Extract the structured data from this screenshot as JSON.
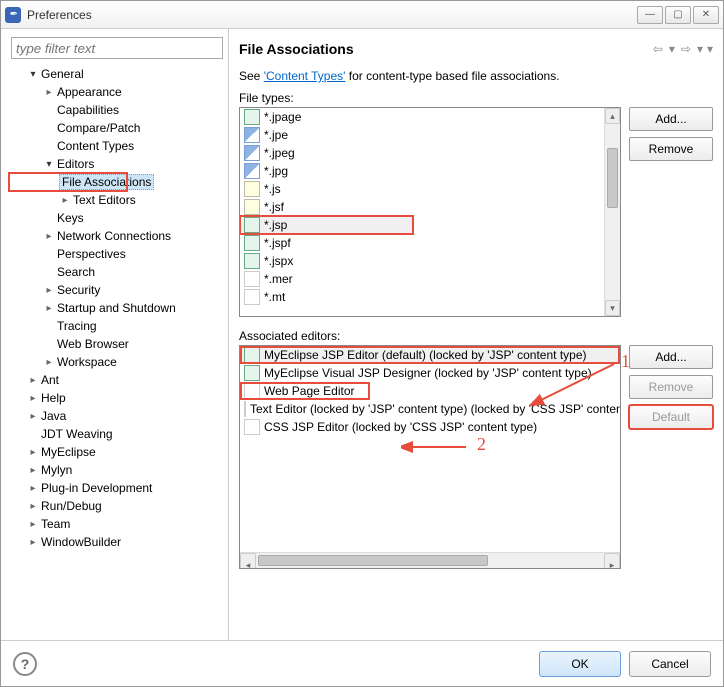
{
  "window": {
    "title": "Preferences"
  },
  "filter_placeholder": "type filter text",
  "tree": {
    "general": "General",
    "appearance": "Appearance",
    "capabilities": "Capabilities",
    "compare": "Compare/Patch",
    "content_types": "Content Types",
    "editors": "Editors",
    "file_assoc": "File Associations",
    "text_editors": "Text Editors",
    "keys": "Keys",
    "network": "Network Connections",
    "perspectives": "Perspectives",
    "search": "Search",
    "security": "Security",
    "startup": "Startup and Shutdown",
    "tracing": "Tracing",
    "web_browser": "Web Browser",
    "workspace": "Workspace",
    "ant": "Ant",
    "help": "Help",
    "java": "Java",
    "jdt": "JDT Weaving",
    "myeclipse": "MyEclipse",
    "mylyn": "Mylyn",
    "plugin": "Plug-in Development",
    "rundebug": "Run/Debug",
    "team": "Team",
    "window_builder": "WindowBuilder"
  },
  "page": {
    "title": "File Associations",
    "intro_pre": "See ",
    "intro_link": "'Content Types'",
    "intro_post": " for content-type based file associations.",
    "file_types_label": "File types:",
    "editors_label": "Associated editors:"
  },
  "file_types": [
    {
      "ext": "*.jpage",
      "icon": "jsp"
    },
    {
      "ext": "*.jpe",
      "icon": "img"
    },
    {
      "ext": "*.jpeg",
      "icon": "img"
    },
    {
      "ext": "*.jpg",
      "icon": "img"
    },
    {
      "ext": "*.js",
      "icon": "js"
    },
    {
      "ext": "*.jsf",
      "icon": "js"
    },
    {
      "ext": "*.jsp",
      "icon": "jsp",
      "selected": true,
      "highlight": true
    },
    {
      "ext": "*.jspf",
      "icon": "jsp"
    },
    {
      "ext": "*.jspx",
      "icon": "jsp"
    },
    {
      "ext": "*.mer",
      "icon": "txt"
    },
    {
      "ext": "*.mt",
      "icon": "txt"
    }
  ],
  "editors": [
    {
      "name": "MyEclipse JSP Editor (default) (locked by 'JSP' content type)",
      "icon": "jsp",
      "selected": true,
      "highlight": true,
      "ann": 1
    },
    {
      "name": "MyEclipse Visual JSP Designer (locked by 'JSP' content type)",
      "icon": "jsp"
    },
    {
      "name": "Web Page Editor",
      "icon": "txt",
      "highlight": true,
      "ann": 2
    },
    {
      "name": "Text Editor (locked by 'JSP' content type) (locked by 'CSS JSP' content type)",
      "icon": "txt"
    },
    {
      "name": "CSS JSP Editor (locked by 'CSS JSP' content type)",
      "icon": "txt"
    }
  ],
  "buttons": {
    "add": "Add...",
    "remove": "Remove",
    "default": "Default",
    "ok": "OK",
    "cancel": "Cancel"
  },
  "annotations": {
    "one": "1",
    "two": "2"
  }
}
